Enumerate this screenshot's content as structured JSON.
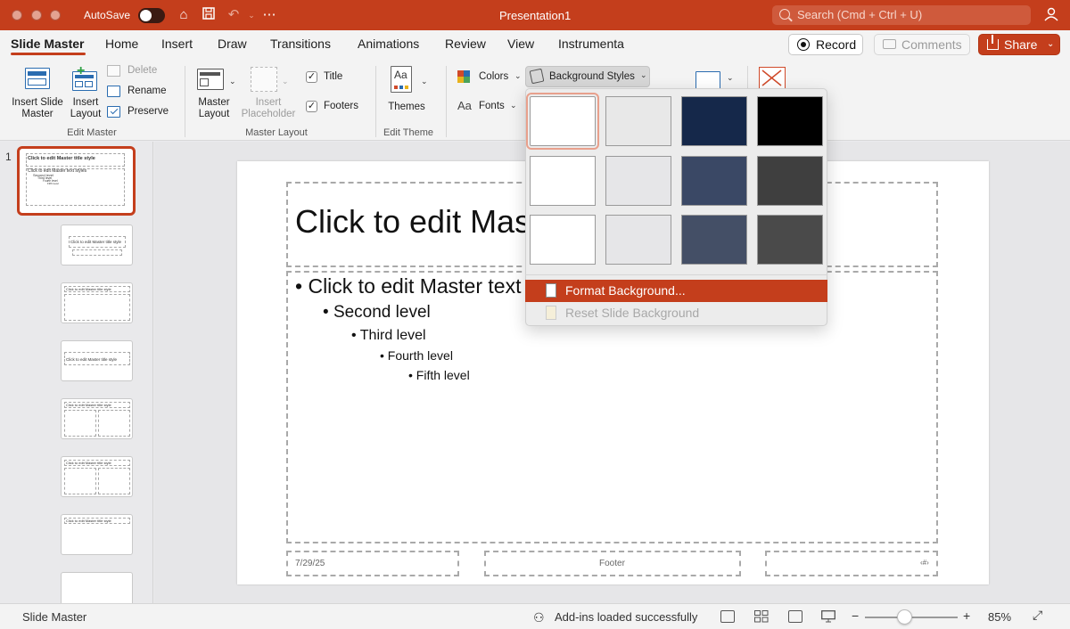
{
  "titlebar": {
    "autosave_label": "AutoSave",
    "title": "Presentation1",
    "search_placeholder": "Search (Cmd + Ctrl + U)",
    "accent": "#c43e1c"
  },
  "tabs": [
    {
      "label": "Slide Master",
      "active": true
    },
    {
      "label": "Home"
    },
    {
      "label": "Insert"
    },
    {
      "label": "Draw"
    },
    {
      "label": "Transitions"
    },
    {
      "label": "Animations"
    },
    {
      "label": "Review"
    },
    {
      "label": "View"
    },
    {
      "label": "Instrumenta"
    }
  ],
  "actions": {
    "record": "Record",
    "comments": "Comments",
    "share": "Share"
  },
  "ribbon": {
    "insert_slide_master": "Insert Slide Master",
    "insert_layout": "Insert Layout",
    "delete": "Delete",
    "rename": "Rename",
    "preserve": "Preserve",
    "edit_master_group": "Edit Master",
    "master_layout": "Master Layout",
    "insert_placeholder": "Insert Placeholder",
    "title_check": "Title",
    "footers_check": "Footers",
    "master_layout_group": "Master Layout",
    "themes": "Themes",
    "edit_theme_group": "Edit Theme",
    "colors": "Colors",
    "fonts": "Fonts",
    "background_styles": "Background Styles"
  },
  "dropdown": {
    "swatches": [
      [
        "#ffffff",
        "#e8e8e8",
        "#15284a",
        "#000000"
      ],
      [
        "#ffffff",
        "#e6e6e8",
        "#3a4865",
        "#3f3f3f"
      ],
      [
        "#ffffff",
        "#e6e6e8",
        "#444f66",
        "#4a4a4a"
      ]
    ],
    "format_background": "Format Background...",
    "reset_slide_background": "Reset Slide Background"
  },
  "slide": {
    "title": "Click to edit Master title style",
    "body_levels": [
      "Click to edit Master text styles",
      "Second level",
      "Third level",
      "Fourth level",
      "Fifth level"
    ],
    "date": "7/29/25",
    "footer": "Footer",
    "slide_number": "‹#›"
  },
  "thumbnails": {
    "number": "1",
    "title": "Click to edit Master title style",
    "text": "Click to edit Master text styles",
    "level2": "Second level",
    "level3": "Third level",
    "level4": "Fourth level",
    "level5": "Fifth level"
  },
  "statusbar": {
    "view_name": "Slide Master",
    "addins": "Add-ins loaded successfully",
    "zoom": "85%"
  }
}
